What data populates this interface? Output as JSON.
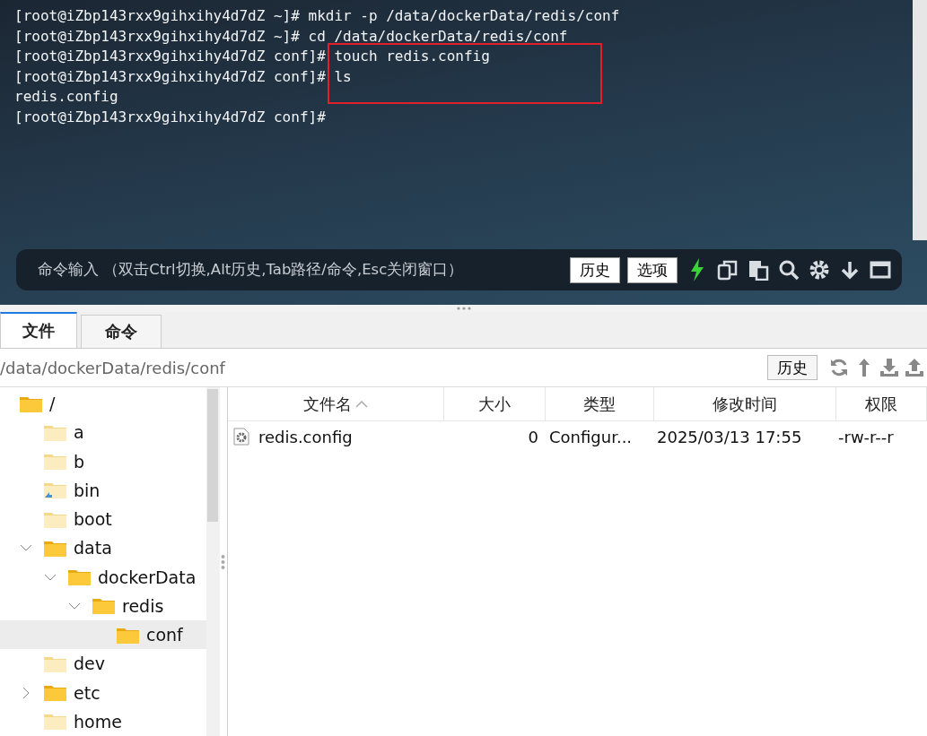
{
  "terminal": {
    "lines": [
      "[root@iZbp143rxx9gihxihy4d7dZ ~]# mkdir -p /data/dockerData/redis/conf",
      "[root@iZbp143rxx9gihxihy4d7dZ ~]# cd /data/dockerData/redis/conf",
      "[root@iZbp143rxx9gihxihy4d7dZ conf]# touch redis.config",
      "[root@iZbp143rxx9gihxihy4d7dZ conf]# ls",
      "redis.config",
      "[root@iZbp143rxx9gihxihy4d7dZ conf]#"
    ]
  },
  "command_bar": {
    "placeholder": "命令输入 （双击Ctrl切换,Alt历史,Tab路径/命令,Esc关闭窗口）",
    "buttons": [
      "历史",
      "选项"
    ]
  },
  "tabs": [
    {
      "label": "文件",
      "selected": true
    },
    {
      "label": "命令",
      "selected": false
    }
  ],
  "path_bar": {
    "value": "/data/dockerData/redis/conf",
    "history_button": "历史"
  },
  "tree": [
    {
      "name": "/",
      "pale": false,
      "link": false,
      "selected": false,
      "children": [
        {
          "name": "a",
          "pale": true,
          "link": false,
          "selected": false
        },
        {
          "name": "b",
          "pale": true,
          "link": false,
          "selected": false
        },
        {
          "name": "bin",
          "pale": true,
          "link": true,
          "selected": false
        },
        {
          "name": "boot",
          "pale": true,
          "link": false,
          "selected": false
        },
        {
          "name": "data",
          "expanded": true,
          "pale": false,
          "link": false,
          "selected": false,
          "children": [
            {
              "name": "dockerData",
              "expanded": true,
              "pale": false,
              "link": false,
              "selected": false,
              "children": [
                {
                  "name": "redis",
                  "expanded": true,
                  "pale": false,
                  "link": false,
                  "selected": false,
                  "children": [
                    {
                      "name": "conf",
                      "pale": false,
                      "link": false,
                      "selected": true
                    }
                  ]
                }
              ]
            }
          ]
        },
        {
          "name": "dev",
          "pale": true,
          "link": false,
          "selected": false
        },
        {
          "name": "etc",
          "expanded": false,
          "pale": false,
          "link": false,
          "selected": false
        },
        {
          "name": "home",
          "pale": true,
          "link": false,
          "selected": false
        }
      ]
    }
  ],
  "table": {
    "columns": [
      {
        "label": "文件名",
        "sorted": true
      },
      {
        "label": "大小",
        "sorted": false
      },
      {
        "label": "类型",
        "sorted": false
      },
      {
        "label": "修改时间",
        "sorted": false
      },
      {
        "label": "权限",
        "sorted": false
      }
    ],
    "rows": [
      {
        "name": "redis.config",
        "size": "0",
        "type": "Configur...",
        "modified": "2025/03/13 17:55",
        "permissions": "-rw-r--r"
      }
    ]
  }
}
